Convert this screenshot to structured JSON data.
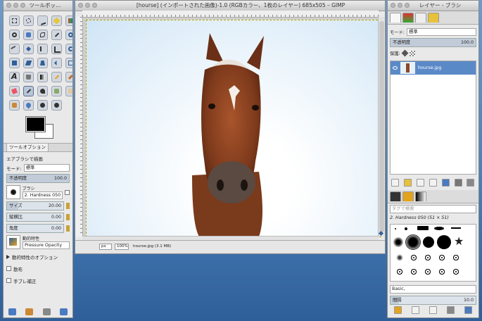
{
  "toolbox": {
    "title": "ツールボッ…",
    "tab_label": "ツールオプション",
    "tool_name": "エアブラシで描画",
    "mode_label": "モード:",
    "mode_value": "標準",
    "opacity_label": "不透明度",
    "opacity_value": "100.0",
    "brush_label": "ブラシ",
    "brush_value": "2. Hardness 050",
    "size_label": "サイズ",
    "size_value": "20.00",
    "aspect_label": "縦横比",
    "aspect_value": "0.00",
    "angle_label": "角度",
    "angle_value": "0.00",
    "dynamics_label": "動的特性",
    "dynamics_value": "Pressure Opacity",
    "dynamics_options_label": "動的特性のオプション",
    "scatter_label": "散布",
    "smooth_label": "手ブレ補正"
  },
  "image_window": {
    "title": "[hourse] (インポートされた画像)-1.0 (RGBカラー、1枚のレイヤー) 685x505 – GIMP",
    "unit": "px",
    "zoom": "100%",
    "status": "hourse.jpg (3.1 MB)"
  },
  "layers": {
    "title": "レイヤー - ブラシ",
    "mode_label": "モード:",
    "mode_value": "標準",
    "opacity_label": "不透明度",
    "opacity_value": "100.0",
    "lock_label": "保護:",
    "layer_name": "hourse.jpg",
    "brush_filter_placeholder": "タグで検索",
    "brush_name": "2. Hardness 050 (51 × 51)",
    "preset": "Basic,",
    "spacing_label": "間隔",
    "spacing_value": "10.0"
  }
}
